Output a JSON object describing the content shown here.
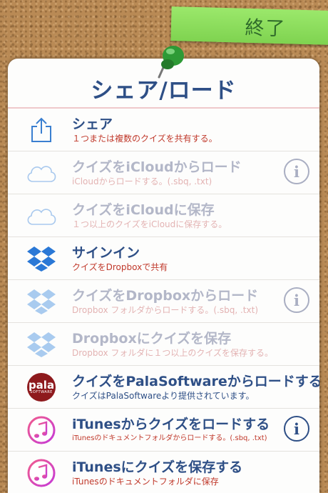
{
  "done_label": "終了",
  "title": "シェア/ロード",
  "rows": [
    {
      "main": "シェア",
      "sub": "１つまたは複数のクイズを共有する。"
    },
    {
      "main": "クイズをiCloudからロード",
      "sub": "iCloudからロードする。(.sbq, .txt)"
    },
    {
      "main": "クイズをiCloudに保存",
      "sub": "１つ以上のクイズをiCloudに保存する。"
    },
    {
      "main": "サインイン",
      "sub": "クイズをDropboxで共有"
    },
    {
      "main": "クイズをDropboxからロード",
      "sub": "Dropbox フォルダからロードする。(.sbq, .txt)"
    },
    {
      "main": "Dropboxにクイズを保存",
      "sub": "Dropbox フォルダに１つ以上のクイズを保存する。"
    },
    {
      "main": "クイズをPalaSoftwareからロードする",
      "sub": "クイズはPalaSoftwareより提供されています。"
    },
    {
      "main": "iTunesからクイズをロードする",
      "sub": "iTunesのドキュメントフォルダからロードする。(.sbq, .txt)"
    },
    {
      "main": "iTunesにクイズを保存する",
      "sub": "iTunesのドキュメントフォルダに保存"
    }
  ],
  "info_glyph": "i",
  "pala_logo": {
    "word": "pala",
    "tagline": "SOFTWARE"
  },
  "colors": {
    "accent": "#2e4f86",
    "sub_text": "#c0392b",
    "note": "#8fdc5e",
    "cork": "#b98a55"
  }
}
